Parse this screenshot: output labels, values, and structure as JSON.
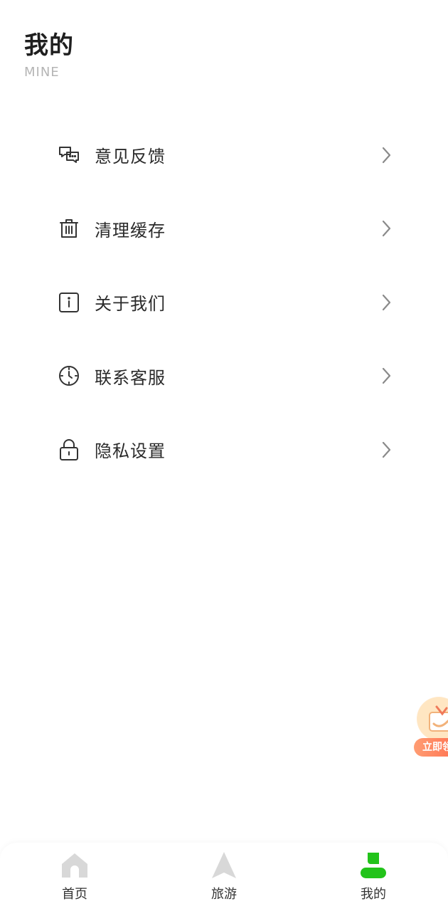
{
  "header": {
    "title": "我的",
    "subtitle": "MINE"
  },
  "menu": {
    "items": [
      {
        "label": "意见反馈",
        "icon": "chat-bubbles-icon"
      },
      {
        "label": "清理缓存",
        "icon": "trash-icon"
      },
      {
        "label": "关于我们",
        "icon": "info-icon"
      },
      {
        "label": "联系客服",
        "icon": "clock-icon"
      },
      {
        "label": "隐私设置",
        "icon": "lock-icon"
      }
    ]
  },
  "float_promo": {
    "label": "立即领"
  },
  "tabbar": {
    "tabs": [
      {
        "label": "首页",
        "icon": "home-icon",
        "active": false
      },
      {
        "label": "旅游",
        "icon": "navigation-arrow-icon",
        "active": false
      },
      {
        "label": "我的",
        "icon": "user-icon",
        "active": true
      }
    ]
  },
  "colors": {
    "active_tab": "#22c31a",
    "inactive_tab": "#d8d8d8",
    "chevron": "#8a8a8a",
    "subtitle": "#b5b5b5"
  }
}
